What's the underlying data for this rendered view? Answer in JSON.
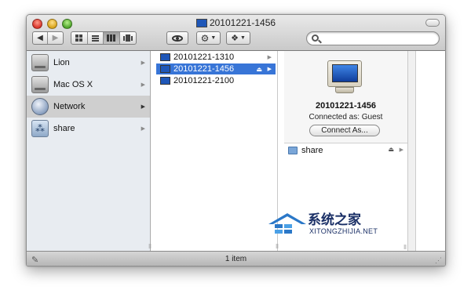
{
  "window": {
    "title": "20101221-1456",
    "toolbar": {
      "back": "◀",
      "forward": "▶",
      "view_buttons": [
        "icon-view",
        "list-view",
        "column-view",
        "coverflow-view"
      ],
      "quicklook": "quicklook-icon",
      "action": "gear-icon",
      "dropbox": "dropbox-icon",
      "search_placeholder": ""
    }
  },
  "sidebar": {
    "items": [
      {
        "label": "Lion",
        "icon": "disk-icon"
      },
      {
        "label": "Mac OS X",
        "icon": "disk-icon"
      },
      {
        "label": "Network",
        "icon": "globe-icon",
        "selected": true
      },
      {
        "label": "share",
        "icon": "share-icon"
      }
    ]
  },
  "column2": {
    "items": [
      {
        "label": "20101221-1310"
      },
      {
        "label": "20101221-1456",
        "selected": true
      },
      {
        "label": "20101221-2100"
      }
    ]
  },
  "preview": {
    "name": "20101221-1456",
    "status": "Connected as: Guest",
    "connect_button": "Connect As...",
    "shares": [
      {
        "label": "share"
      }
    ]
  },
  "statusbar": {
    "text": "1 item"
  },
  "watermark": {
    "cn": "系统之家",
    "en": "XITONGZHIJIA.NET"
  },
  "colors": {
    "selection": "#3875d7",
    "sidebar_bg": "#e8ecf1"
  }
}
